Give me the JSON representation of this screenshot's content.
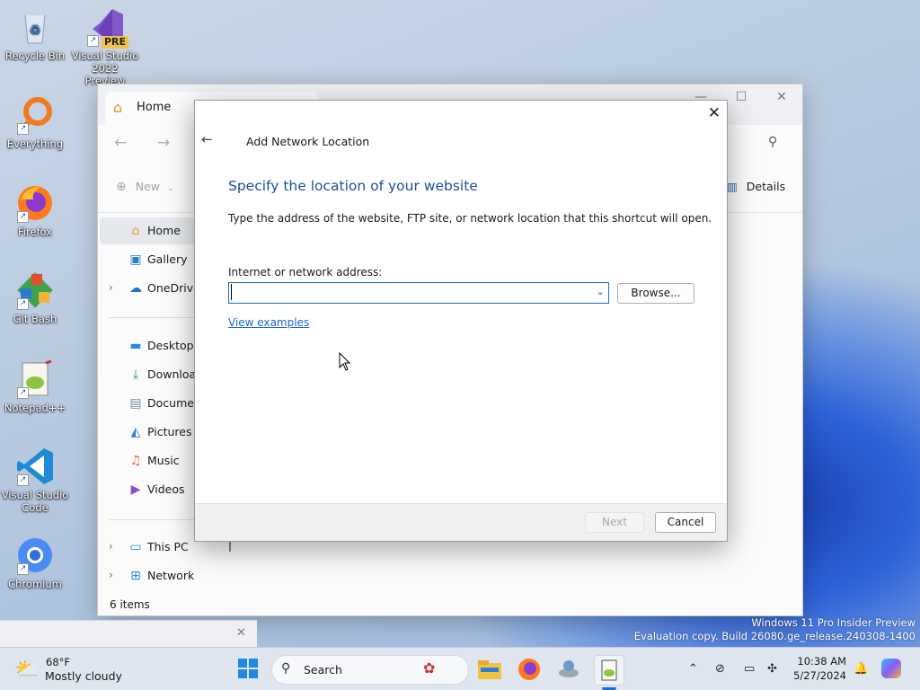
{
  "desktop": {
    "icons": [
      {
        "label": "Recycle Bin"
      },
      {
        "label": "Visual Studio 2022 Preview",
        "badge": "PRE"
      },
      {
        "label": "Everything"
      },
      {
        "label": "Firefox"
      },
      {
        "label": "Git Bash"
      },
      {
        "label": "Notepad++"
      },
      {
        "label": "Visual Studio Code"
      },
      {
        "label": "Chromium"
      }
    ],
    "watermark": {
      "line1": "Windows 11 Pro Insider Preview",
      "line2": "Evaluation copy. Build 26080.ge_release.240308-1400"
    }
  },
  "explorer": {
    "tab_title": "Home",
    "toolbar": {
      "new_label": "New",
      "details_label": "Details"
    },
    "sidebar": {
      "items": [
        {
          "label": "Home",
          "icon": "home-icon"
        },
        {
          "label": "Gallery",
          "icon": "gallery-icon"
        },
        {
          "label": "OneDrive",
          "icon": "cloud-icon"
        },
        {
          "label": "Desktop",
          "icon": "desktop-icon"
        },
        {
          "label": "Downloads",
          "icon": "download-icon"
        },
        {
          "label": "Documents",
          "icon": "document-icon"
        },
        {
          "label": "Pictures",
          "icon": "pictures-icon"
        },
        {
          "label": "Music",
          "icon": "music-icon"
        },
        {
          "label": "Videos",
          "icon": "videos-icon"
        },
        {
          "label": "This PC",
          "icon": "computer-icon"
        },
        {
          "label": "Network",
          "icon": "network-icon"
        }
      ]
    },
    "status": "6 items"
  },
  "dialog": {
    "title": "Add Network Location",
    "heading": "Specify the location of your website",
    "description": "Type the address of the website, FTP site, or network location that this shortcut will open.",
    "address_label": "Internet or network address:",
    "address_value": "",
    "browse_label": "Browse...",
    "examples_link": "View examples",
    "next_label": "Next",
    "cancel_label": "Cancel",
    "accent": "#1e4e9c"
  },
  "taskbar": {
    "weather": {
      "temp": "68°F",
      "condition": "Mostly cloudy"
    },
    "search_label": "Search",
    "clock": {
      "time": "10:38 AM",
      "date": "5/27/2024"
    }
  }
}
